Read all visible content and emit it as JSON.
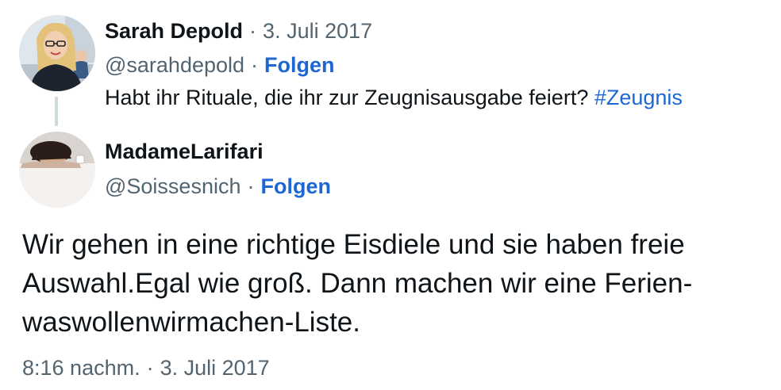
{
  "parent_tweet": {
    "author_name": "Sarah Depold",
    "date": "3. Juli 2017",
    "handle": "@sarahdepold",
    "follow_label": "Folgen",
    "text": "Habt ihr Rituale, die ihr zur Zeugnisausgabe feiert?",
    "hashtag": "#Zeugnis",
    "avatar_icon": "profile-photo-woman-glasses"
  },
  "reply_tweet": {
    "author_name": "MadameLarifari",
    "handle": "@Soissesnich",
    "follow_label": "Folgen",
    "avatar_icon": "profile-photo-woman-resting-on-table",
    "text_lines": [
      "Wir gehen in eine richtige Eisdiele und sie haben freie",
      "Auswahl.Egal wie groß. Dann machen wir eine Ferien-",
      "waswollenwirmachen-Liste."
    ],
    "time": "8:16 nachm.",
    "date": "3. Juli 2017"
  },
  "separator": "·",
  "colors": {
    "link": "#1d67d4",
    "muted": "#536471",
    "text": "#0f1419",
    "thread_line": "#cfd9de"
  }
}
